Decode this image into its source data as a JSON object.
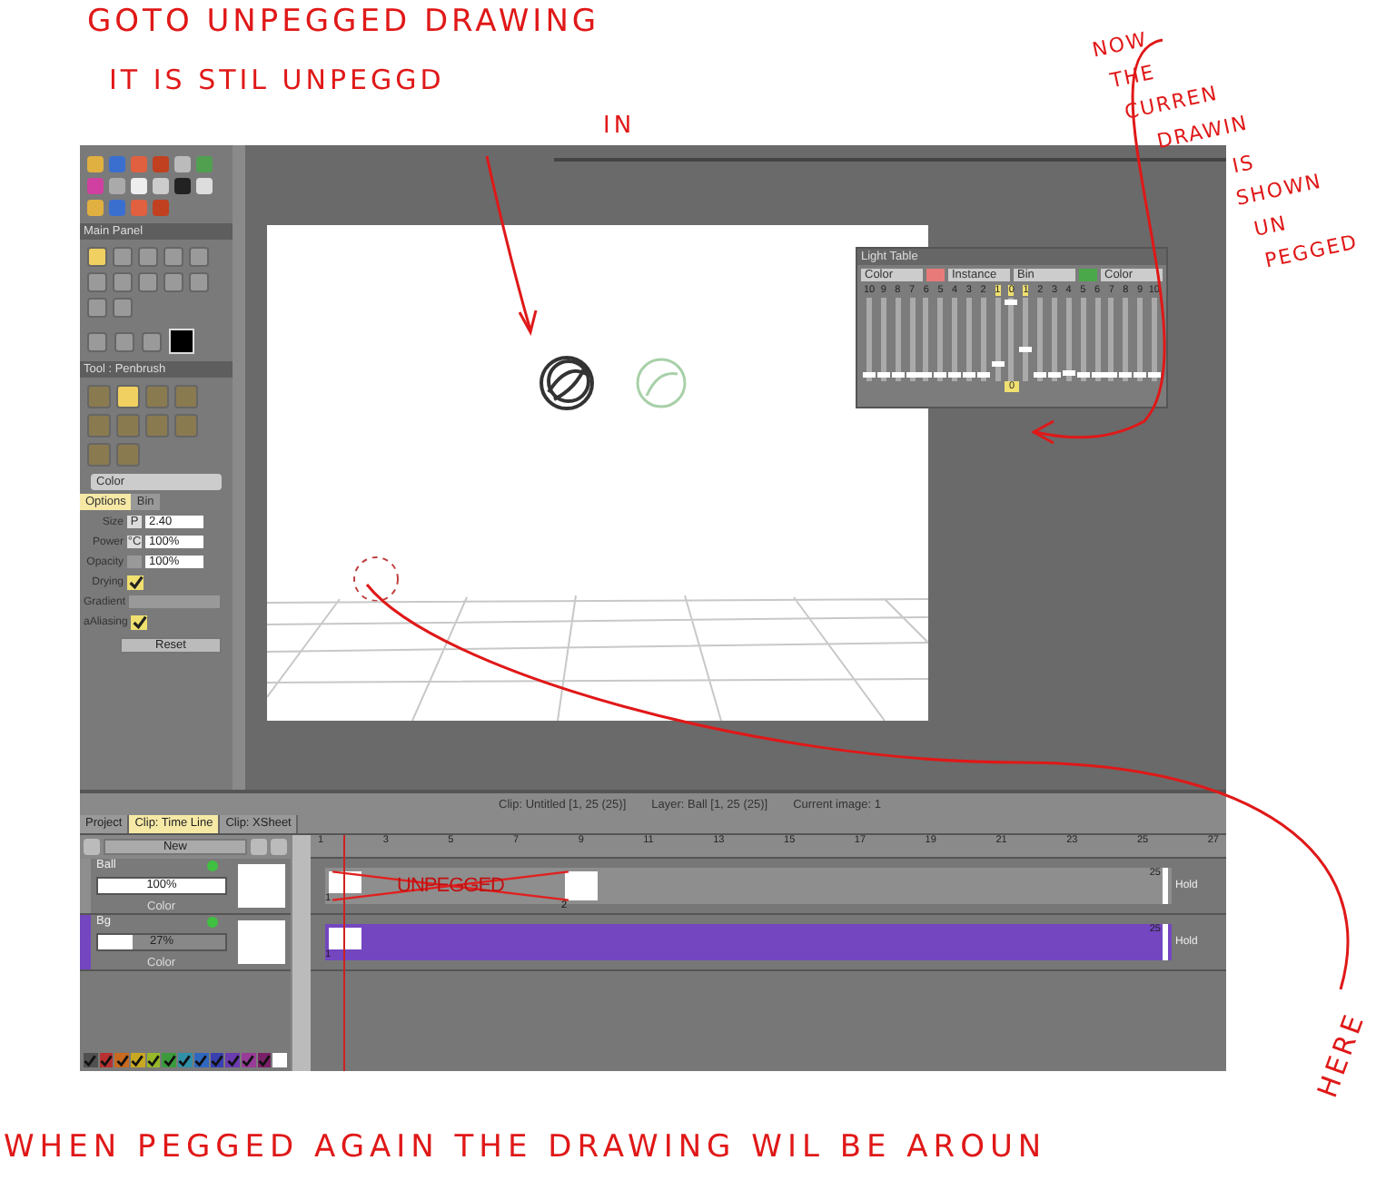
{
  "annotations": {
    "top_lines": [
      "GOTO UNPEGGED  DRAWING",
      "IT IS  STIL UNPEGGD"
    ],
    "in_label": "IN",
    "side_lines": [
      "NOW",
      "THE",
      "CURREN",
      "DRAWIN",
      "IS",
      "SHOWN",
      "UN",
      "PEGGED"
    ],
    "bottom_line": "WHEN PEGGED AGAIN  THE DRAWING WIL BE AROUN",
    "bottom_end": "HERE"
  },
  "main_panel": {
    "title": "Main Panel",
    "tools": [
      {
        "selected": true
      },
      {
        "selected": false
      },
      {
        "selected": false
      },
      {
        "selected": false
      },
      {
        "selected": false
      },
      {
        "selected": false
      },
      {
        "selected": false
      },
      {
        "selected": false
      },
      {
        "selected": false
      },
      {
        "selected": false
      },
      {
        "selected": false
      },
      {
        "selected": false
      }
    ]
  },
  "tool_panel": {
    "title": "Tool : Penbrush",
    "brushes": [
      {
        "selected": false
      },
      {
        "selected": true
      },
      {
        "selected": false
      },
      {
        "selected": false
      },
      {
        "selected": false
      },
      {
        "selected": false
      },
      {
        "selected": false
      },
      {
        "selected": false
      },
      {
        "selected": false
      },
      {
        "selected": false
      }
    ],
    "mode": "Color",
    "tabs": [
      {
        "label": "Options",
        "selected": true
      },
      {
        "label": "Bin",
        "selected": false
      }
    ],
    "options": [
      {
        "kind": "field",
        "label": "Size",
        "prefix": "P",
        "value": "2.40"
      },
      {
        "kind": "field",
        "label": "Power",
        "prefix": "°C",
        "value": "100%"
      },
      {
        "kind": "field",
        "label": "Opacity",
        "value": "100%"
      },
      {
        "kind": "check",
        "label": "Drying",
        "checked": true
      },
      {
        "kind": "bar",
        "label": "Gradient"
      },
      {
        "kind": "check",
        "label": "aAliasing",
        "checked": true
      }
    ],
    "reset": "Reset"
  },
  "light_table": {
    "title": "Light Table",
    "controls": [
      {
        "kind": "select",
        "value": "Color"
      },
      {
        "kind": "swatch",
        "color": "#e87a7a"
      },
      {
        "kind": "select",
        "value": "Instance"
      },
      {
        "kind": "select",
        "value": "Bin"
      },
      {
        "kind": "swatch",
        "color": "#4aa84a"
      },
      {
        "kind": "select",
        "value": "Color"
      }
    ],
    "sliders": [
      {
        "label": "10",
        "selected": false,
        "level": 0.05
      },
      {
        "label": "9",
        "selected": false,
        "level": 0.05
      },
      {
        "label": "8",
        "selected": false,
        "level": 0.05
      },
      {
        "label": "7",
        "selected": false,
        "level": 0.05
      },
      {
        "label": "6",
        "selected": false,
        "level": 0.05
      },
      {
        "label": "5",
        "selected": false,
        "level": 0.05
      },
      {
        "label": "4",
        "selected": false,
        "level": 0.05
      },
      {
        "label": "3",
        "selected": false,
        "level": 0.05
      },
      {
        "label": "2",
        "selected": false,
        "level": 0.05
      },
      {
        "label": "1",
        "selected": true,
        "level": 0.2
      },
      {
        "label": "0",
        "selected": true,
        "level": 1
      },
      {
        "label": "1",
        "selected": true,
        "level": 0.37
      },
      {
        "label": "2",
        "selected": false,
        "level": 0.05
      },
      {
        "label": "3",
        "selected": false,
        "level": 0.05
      },
      {
        "label": "4",
        "selected": false,
        "level": 0.08
      },
      {
        "label": "5",
        "selected": false,
        "level": 0.05
      },
      {
        "label": "6",
        "selected": false,
        "level": 0.05
      },
      {
        "label": "7",
        "selected": false,
        "level": 0.05
      },
      {
        "label": "8",
        "selected": false,
        "level": 0.05
      },
      {
        "label": "9",
        "selected": false,
        "level": 0.05
      },
      {
        "label": "10",
        "selected": false,
        "level": 0.05
      }
    ],
    "current": "0"
  },
  "status_bar": {
    "clip": "Clip: Untitled [1, 25 (25)]",
    "layer": "Layer: Ball [1, 25 (25)]",
    "image": "Current image: 1"
  },
  "tabs": [
    {
      "label": "Project",
      "selected": false
    },
    {
      "label": "Clip: Time Line",
      "selected": true
    },
    {
      "label": "Clip: XSheet",
      "selected": false
    }
  ],
  "timeline": {
    "new_button": "New",
    "ruler": [
      "1",
      "3",
      "5",
      "7",
      "9",
      "11",
      "13",
      "15",
      "17",
      "19",
      "21",
      "23",
      "25",
      "27"
    ],
    "layers": [
      {
        "name": "Ball",
        "opacity": "100%",
        "level": 1,
        "mode": "Color",
        "color": "#8e8e8e",
        "frames": [
          "1",
          "2"
        ],
        "marker": "UNPEGGED",
        "end": "25",
        "hold": "Hold"
      },
      {
        "name": "Bg",
        "opacity": "27%",
        "level": 0.27,
        "mode": "Color",
        "color": "#7446c0",
        "frames": [
          "1"
        ],
        "end": "25",
        "hold": "Hold"
      }
    ],
    "palette": [
      {
        "color": "#505050",
        "checked": true
      },
      {
        "color": "#b83030",
        "checked": true
      },
      {
        "color": "#c86a20",
        "checked": true
      },
      {
        "color": "#c8a820",
        "checked": true
      },
      {
        "color": "#98b828",
        "checked": true
      },
      {
        "color": "#3c9a3c",
        "checked": true
      },
      {
        "color": "#3090a8",
        "checked": true
      },
      {
        "color": "#3068c0",
        "checked": true
      },
      {
        "color": "#3840b0",
        "checked": true
      },
      {
        "color": "#6a3cb0",
        "checked": true
      },
      {
        "color": "#983c98",
        "checked": true
      },
      {
        "color": "#7a2068",
        "checked": true
      },
      {
        "color": "#ffffff",
        "checked": false
      }
    ]
  }
}
